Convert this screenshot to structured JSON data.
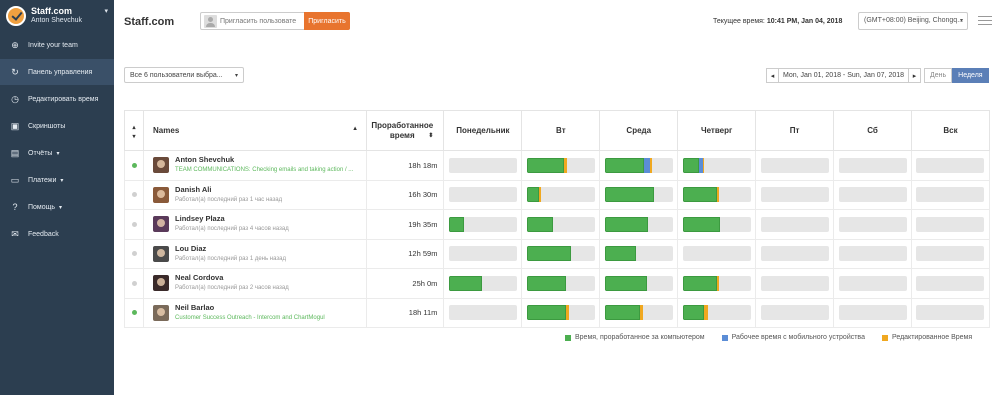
{
  "brand": {
    "name": "Staff.com",
    "user": "Anton Shevchuk"
  },
  "sidebar": {
    "items": [
      {
        "label": "Invite your team",
        "icon": "add-user-icon",
        "active": false,
        "has_caret": false
      },
      {
        "label": "Панель управления",
        "icon": "refresh-icon",
        "active": true,
        "has_caret": false
      },
      {
        "label": "Редактировать время",
        "icon": "clock-edit-icon",
        "active": false,
        "has_caret": false
      },
      {
        "label": "Скриншоты",
        "icon": "image-icon",
        "active": false,
        "has_caret": false
      },
      {
        "label": "Отчёты",
        "icon": "report-icon",
        "active": false,
        "has_caret": true
      },
      {
        "label": "Платежи",
        "icon": "card-icon",
        "active": false,
        "has_caret": true
      },
      {
        "label": "Помощь",
        "icon": "help-icon",
        "active": false,
        "has_caret": true
      },
      {
        "label": "Feedback",
        "icon": "feedback-icon",
        "active": false,
        "has_caret": false
      }
    ]
  },
  "header": {
    "title": "Staff.com",
    "invite_placeholder": "Пригласить пользовате",
    "invite_button": "Пригласить",
    "time_prefix": "Текущее время:",
    "time_value": "10:41 PM, Jan 04, 2018",
    "timezone": "(GMT+08:00) Beijing, Chongq..."
  },
  "toolbar": {
    "users_select": "Все 6 пользователи выбра...",
    "date_range": "Mon, Jan 01, 2018 - Sun, Jan 07, 2018",
    "view_day": "День",
    "view_week": "Неделя"
  },
  "table": {
    "col_names": "Names",
    "col_time": "Проработанное время",
    "days": [
      "Понедельник",
      "Вт",
      "Среда",
      "Четверг",
      "Пт",
      "Сб",
      "Вск"
    ],
    "rows": [
      {
        "name": "Anton Shevchuk",
        "status": "TEAM COMMUNICATIONS: Checking emails and taking action / ...",
        "online": true,
        "time": "18h 18m",
        "avatar_color": "#6a4a3a",
        "days": [
          {
            "c": 0,
            "m": 0,
            "e": 0
          },
          {
            "c": 0.55,
            "m": 0,
            "e": 0.04
          },
          {
            "c": 0.58,
            "m": 0.08,
            "e": 0.04
          },
          {
            "c": 0.24,
            "m": 0.06,
            "e": 0.02
          },
          {
            "c": 0,
            "m": 0,
            "e": 0
          },
          {
            "c": 0,
            "m": 0,
            "e": 0
          },
          {
            "c": 0,
            "m": 0,
            "e": 0
          }
        ]
      },
      {
        "name": "Danish Ali",
        "status": "Работал(а) последний раз 1 час назад",
        "online": false,
        "time": "16h 30m",
        "avatar_color": "#8a5a3a",
        "days": [
          {
            "c": 0,
            "m": 0,
            "e": 0
          },
          {
            "c": 0.18,
            "m": 0,
            "e": 0.03
          },
          {
            "c": 0.72,
            "m": 0,
            "e": 0
          },
          {
            "c": 0.5,
            "m": 0,
            "e": 0.04
          },
          {
            "c": 0,
            "m": 0,
            "e": 0
          },
          {
            "c": 0,
            "m": 0,
            "e": 0
          },
          {
            "c": 0,
            "m": 0,
            "e": 0
          }
        ]
      },
      {
        "name": "Lindsey Plaza",
        "status": "Работал(а) последний раз 4 часов назад",
        "online": false,
        "time": "19h 35m",
        "avatar_color": "#5a3a5a",
        "days": [
          {
            "c": 0.22,
            "m": 0,
            "e": 0
          },
          {
            "c": 0.38,
            "m": 0,
            "e": 0
          },
          {
            "c": 0.64,
            "m": 0,
            "e": 0
          },
          {
            "c": 0.55,
            "m": 0,
            "e": 0
          },
          {
            "c": 0,
            "m": 0,
            "e": 0
          },
          {
            "c": 0,
            "m": 0,
            "e": 0
          },
          {
            "c": 0,
            "m": 0,
            "e": 0
          }
        ]
      },
      {
        "name": "Lou Diaz",
        "status": "Работал(а) последний раз 1 день назад",
        "online": false,
        "time": "12h 59m",
        "avatar_color": "#4a4a4a",
        "days": [
          {
            "c": 0,
            "m": 0,
            "e": 0
          },
          {
            "c": 0.65,
            "m": 0,
            "e": 0
          },
          {
            "c": 0.46,
            "m": 0,
            "e": 0
          },
          {
            "c": 0,
            "m": 0,
            "e": 0
          },
          {
            "c": 0,
            "m": 0,
            "e": 0
          },
          {
            "c": 0,
            "m": 0,
            "e": 0
          },
          {
            "c": 0,
            "m": 0,
            "e": 0
          }
        ]
      },
      {
        "name": "Neal Cordova",
        "status": "Работал(а) последний раз 2 часов назад",
        "online": false,
        "time": "25h 0m",
        "avatar_color": "#3a2a2a",
        "days": [
          {
            "c": 0.48,
            "m": 0,
            "e": 0
          },
          {
            "c": 0.58,
            "m": 0,
            "e": 0
          },
          {
            "c": 0.62,
            "m": 0,
            "e": 0
          },
          {
            "c": 0.5,
            "m": 0,
            "e": 0.04
          },
          {
            "c": 0,
            "m": 0,
            "e": 0
          },
          {
            "c": 0,
            "m": 0,
            "e": 0
          },
          {
            "c": 0,
            "m": 0,
            "e": 0
          }
        ]
      },
      {
        "name": "Neil Barlao",
        "status": "Customer Success Outreach - Intercom and ChartMogul",
        "online": true,
        "time": "18h 11m",
        "avatar_color": "#7a6a5a",
        "days": [
          {
            "c": 0,
            "m": 0,
            "e": 0
          },
          {
            "c": 0.58,
            "m": 0,
            "e": 0.04
          },
          {
            "c": 0.52,
            "m": 0,
            "e": 0.05
          },
          {
            "c": 0.32,
            "m": 0,
            "e": 0.06
          },
          {
            "c": 0,
            "m": 0,
            "e": 0
          },
          {
            "c": 0,
            "m": 0,
            "e": 0
          },
          {
            "c": 0,
            "m": 0,
            "e": 0
          }
        ]
      }
    ]
  },
  "legend": [
    {
      "label": "Время, проработанное за компьютером",
      "color": "#4caf50"
    },
    {
      "label": "Рабочее время с мобильного устройства",
      "color": "#5b8dd6"
    },
    {
      "label": "Редактированное Время",
      "color": "#f0a820"
    }
  ],
  "colors": {
    "online": "#5cb85c",
    "offline": "#d0d0d0"
  }
}
